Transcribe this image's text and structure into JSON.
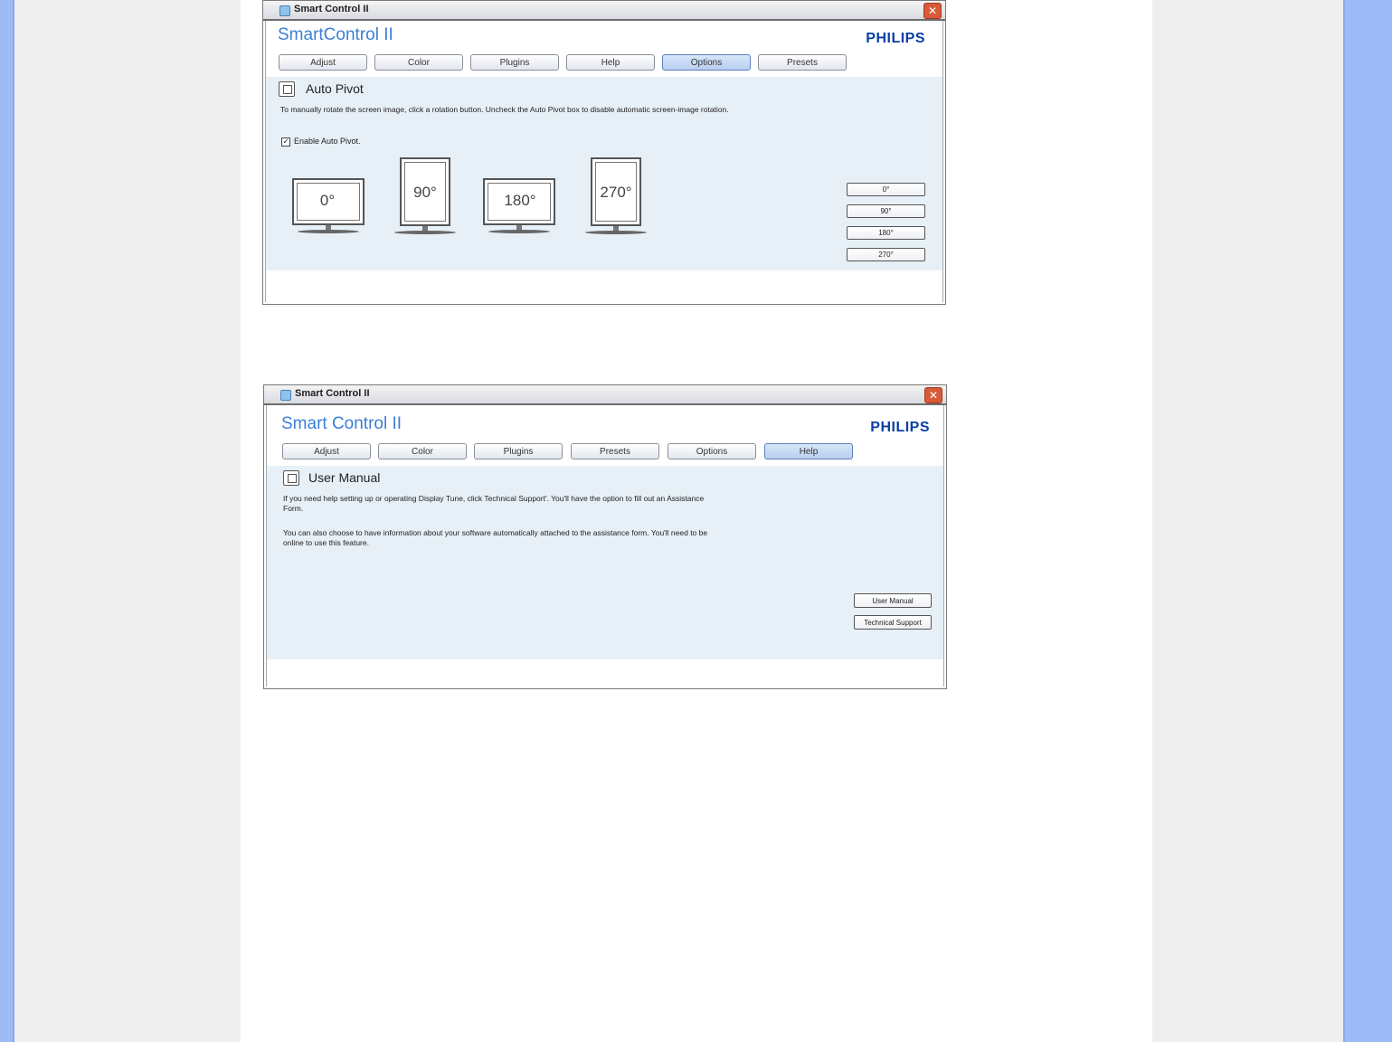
{
  "window1": {
    "title": "Smart Control II",
    "brand_title": "SmartControl II",
    "logo": "PHILIPS",
    "tabs": [
      {
        "label": "Adjust"
      },
      {
        "label": "Color"
      },
      {
        "label": "Plugins"
      },
      {
        "label": "Help"
      },
      {
        "label": "Options"
      },
      {
        "label": "Presets"
      }
    ],
    "active_tab": "Options",
    "section_title": "Auto Pivot",
    "description": "To manually rotate the screen image, click a rotation button. Uncheck the Auto Pivot box to disable automatic screen-image rotation.",
    "checkbox_label": "Enable Auto Pivot.",
    "checkbox_checked": true,
    "monitors": [
      {
        "label": "0°"
      },
      {
        "label": "90°"
      },
      {
        "label": "180°"
      },
      {
        "label": "270°"
      }
    ],
    "rotation_buttons": [
      {
        "label": "0°"
      },
      {
        "label": "90°"
      },
      {
        "label": "180°"
      },
      {
        "label": "270°"
      }
    ]
  },
  "window2": {
    "title": "Smart Control II",
    "brand_title": "Smart Control II",
    "logo": "PHILIPS",
    "tabs": [
      {
        "label": "Adjust"
      },
      {
        "label": "Color"
      },
      {
        "label": "Plugins"
      },
      {
        "label": "Presets"
      },
      {
        "label": "Options"
      },
      {
        "label": "Help"
      }
    ],
    "active_tab": "Help",
    "section_title": "User Manual",
    "description1": "If you need help setting up or operating Display Tune, click Technical Support'. You'll have the option to fill out an Assistance Form.",
    "description2": "You can also choose to have information about your software automatically attached to the assistance form. You'll need to be online to use this feature.",
    "buttons": [
      {
        "label": "User Manual"
      },
      {
        "label": "Technical Support"
      }
    ]
  },
  "colors": {
    "brand_blue": "#3b7fd6",
    "philips_blue": "#0b3fa6",
    "panel_bg": "#e7f0f7",
    "page_side": "#9dbcf7"
  },
  "icons": {
    "close": "close-icon",
    "auto_pivot": "pivot-icon",
    "user_manual": "manual-icon"
  }
}
